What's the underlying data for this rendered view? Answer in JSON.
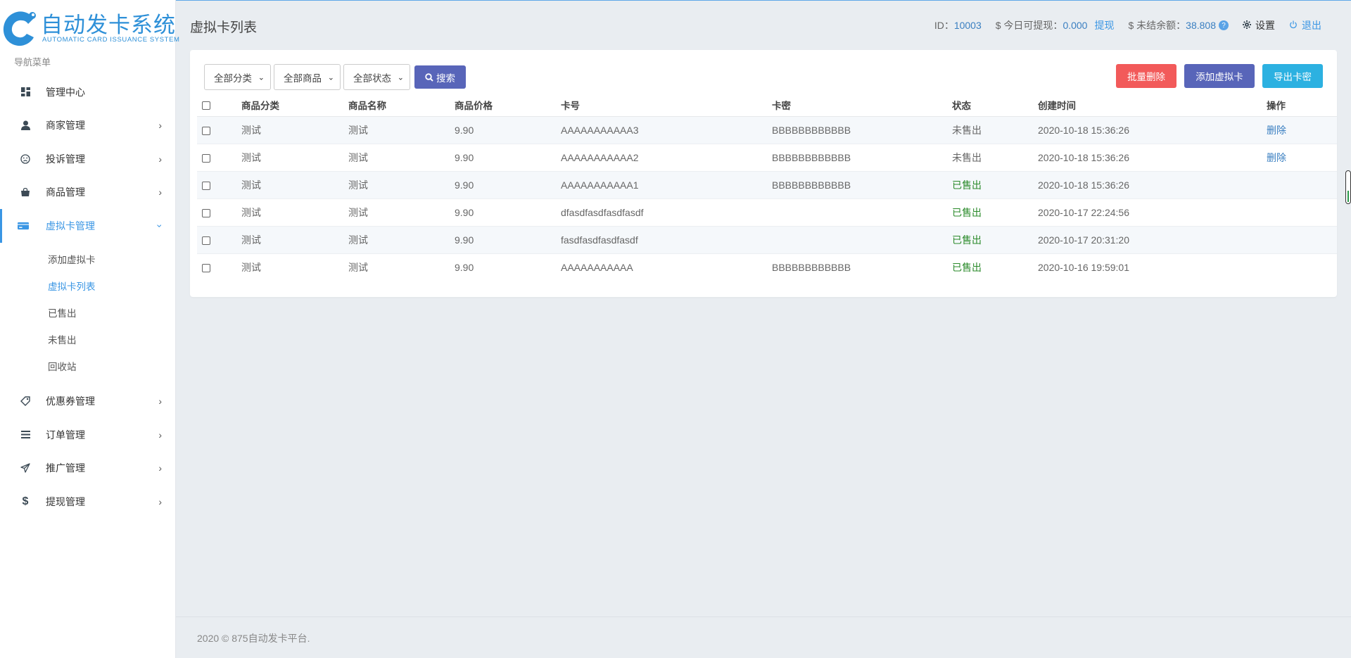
{
  "app": {
    "logo_title": "自动发卡系统",
    "logo_subtitle": "AUTOMATIC CARD ISSUANCE SYSTEM",
    "brand_color": "#2e90d8"
  },
  "sidebar": {
    "nav_label": "导航菜单",
    "items": [
      {
        "label": "管理中心",
        "icon": "dashboard-icon",
        "has_chevron": false
      },
      {
        "label": "商家管理",
        "icon": "user-icon",
        "has_chevron": true
      },
      {
        "label": "投诉管理",
        "icon": "frown-icon",
        "has_chevron": true
      },
      {
        "label": "商品管理",
        "icon": "shopping-bag-icon",
        "has_chevron": true
      },
      {
        "label": "虚拟卡管理",
        "icon": "credit-card-icon",
        "has_chevron": true,
        "expanded": true
      },
      {
        "label": "优惠券管理",
        "icon": "tag-icon",
        "has_chevron": true
      },
      {
        "label": "订单管理",
        "icon": "list-icon",
        "has_chevron": true
      },
      {
        "label": "推广管理",
        "icon": "paper-plane-icon",
        "has_chevron": true
      },
      {
        "label": "提现管理",
        "icon": "dollar-icon",
        "has_chevron": true
      }
    ],
    "subitems": [
      {
        "label": "添加虚拟卡"
      },
      {
        "label": "虚拟卡列表",
        "current": true
      },
      {
        "label": "已售出"
      },
      {
        "label": "未售出"
      },
      {
        "label": "回收站"
      }
    ]
  },
  "header": {
    "title": "虚拟卡列表",
    "id_label": "ID：",
    "id_value": "10003",
    "withdrawable_label": "$ 今日可提现：",
    "withdrawable_value": "0.000",
    "withdraw_link": "提现",
    "unsettled_label": "$ 未结余额：",
    "unsettled_value": "38.808",
    "help_mark": "?",
    "settings_label": "设置",
    "logout_label": "退出"
  },
  "filters": {
    "category": "全部分类",
    "product": "全部商品",
    "status": "全部状态",
    "search_label": "搜索"
  },
  "actions": {
    "batch_delete": "批量删除",
    "add_card": "添加虚拟卡",
    "export": "导出卡密"
  },
  "table": {
    "columns": [
      "商品分类",
      "商品名称",
      "商品价格",
      "卡号",
      "卡密",
      "状态",
      "创建时间",
      "操作"
    ],
    "rows": [
      {
        "category": "测试",
        "name": "测试",
        "price": "9.90",
        "card_no": "AAAAAAAAAAA3",
        "card_secret": "BBBBBBBBBBBB",
        "status": "未售出",
        "sold": false,
        "created": "2020-10-18 15:36:26",
        "op": "删除"
      },
      {
        "category": "测试",
        "name": "测试",
        "price": "9.90",
        "card_no": "AAAAAAAAAAA2",
        "card_secret": "BBBBBBBBBBBB",
        "status": "未售出",
        "sold": false,
        "created": "2020-10-18 15:36:26",
        "op": "删除"
      },
      {
        "category": "测试",
        "name": "测试",
        "price": "9.90",
        "card_no": "AAAAAAAAAAA1",
        "card_secret": "BBBBBBBBBBBB",
        "status": "已售出",
        "sold": true,
        "created": "2020-10-18 15:36:26",
        "op": ""
      },
      {
        "category": "测试",
        "name": "测试",
        "price": "9.90",
        "card_no": "dfasdfasdfasdfasdf",
        "card_secret": "",
        "status": "已售出",
        "sold": true,
        "created": "2020-10-17 22:24:56",
        "op": ""
      },
      {
        "category": "测试",
        "name": "测试",
        "price": "9.90",
        "card_no": "fasdfasdfasdfasdf",
        "card_secret": "",
        "status": "已售出",
        "sold": true,
        "created": "2020-10-17 20:31:20",
        "op": ""
      },
      {
        "category": "测试",
        "name": "测试",
        "price": "9.90",
        "card_no": "AAAAAAAAAAA",
        "card_secret": "BBBBBBBBBBBB",
        "status": "已售出",
        "sold": true,
        "created": "2020-10-16 19:59:01",
        "op": ""
      }
    ]
  },
  "footer": {
    "text": "2020 © 875自动发卡平台."
  },
  "colors": {
    "accent": "#3a96e4",
    "danger": "#f25a5a",
    "indigo": "#5865b9",
    "cyan": "#2cb1e1",
    "sold": "#2a8a2a"
  }
}
